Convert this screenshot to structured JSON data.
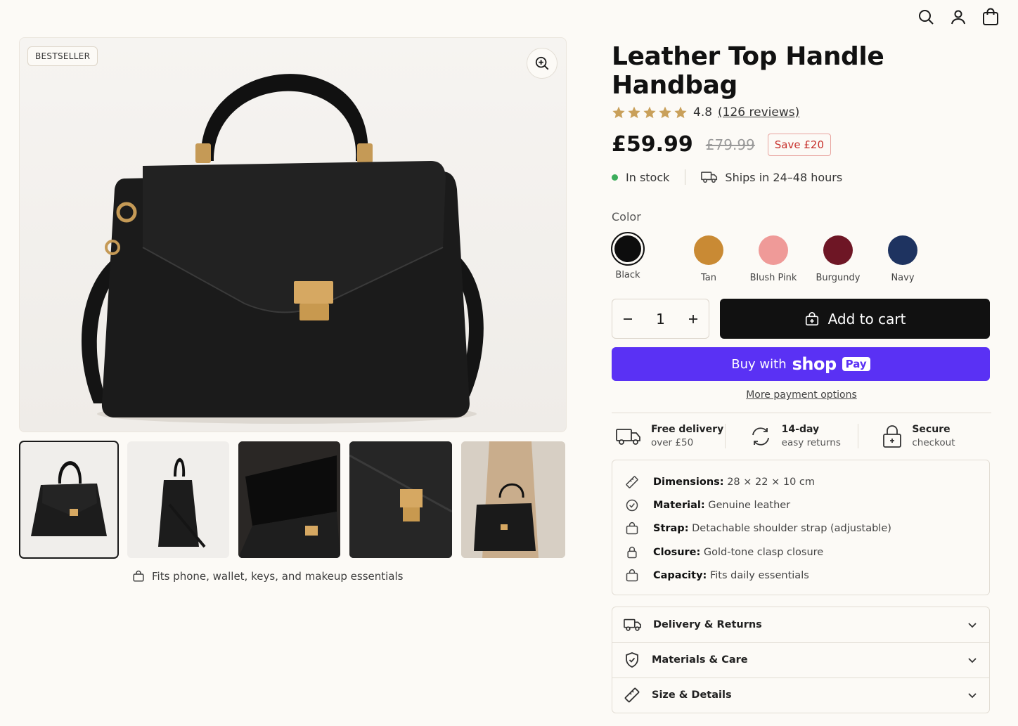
{
  "header": {
    "icons": [
      "search-icon",
      "account-icon",
      "cart-icon"
    ]
  },
  "gallery": {
    "badge": "BESTSELLER",
    "thumbnails": [
      "front view",
      "side view",
      "interior view",
      "clasp detail",
      "worn on shoulder"
    ],
    "selected_thumbnail": 0,
    "fits_note": "Fits phone, wallet, keys, and makeup essentials"
  },
  "product": {
    "title": "Leather Top Handle Handbag",
    "rating": "4.8",
    "reviews": "(126 reviews)",
    "price": "£59.99",
    "compare_price": "£79.99",
    "save": "Save £20",
    "stock": "In stock",
    "shipping": "Ships in 24–48 hours",
    "color_label": "Color",
    "colors": [
      {
        "name": "Black",
        "hex": "#0d0d0d"
      },
      {
        "name": "Tan",
        "hex": "#c98a34"
      },
      {
        "name": "Blush Pink",
        "hex": "#ef9a98"
      },
      {
        "name": "Burgundy",
        "hex": "#6e1625"
      },
      {
        "name": "Navy",
        "hex": "#1e3360"
      }
    ],
    "selected_color": "Black",
    "quantity": "1",
    "add_to_cart": "Add to cart",
    "shop_pay_prefix": "Buy with",
    "shop_pay_brand": "shop",
    "shop_pay_badge": "Pay",
    "more_payment": "More payment options"
  },
  "perks": [
    {
      "title": "Free delivery",
      "sub": "over £50"
    },
    {
      "title": "14-day",
      "sub": "easy returns"
    },
    {
      "title": "Secure",
      "sub": "checkout"
    }
  ],
  "specs": [
    {
      "label": "Dimensions:",
      "value": "28 × 22 × 10 cm"
    },
    {
      "label": "Material:",
      "value": "Genuine leather"
    },
    {
      "label": "Strap:",
      "value": "Detachable shoulder strap (adjustable)"
    },
    {
      "label": "Closure:",
      "value": "Gold-tone clasp closure"
    },
    {
      "label": "Capacity:",
      "value": "Fits daily essentials"
    }
  ],
  "accordion": [
    {
      "label": "Delivery & Returns"
    },
    {
      "label": "Materials & Care"
    },
    {
      "label": "Size & Details"
    }
  ],
  "colors": {
    "accent_shop": "#5a31f4",
    "sale_red": "#c7312c",
    "star": "#c9a05a",
    "stock_green": "#3cad5b"
  }
}
